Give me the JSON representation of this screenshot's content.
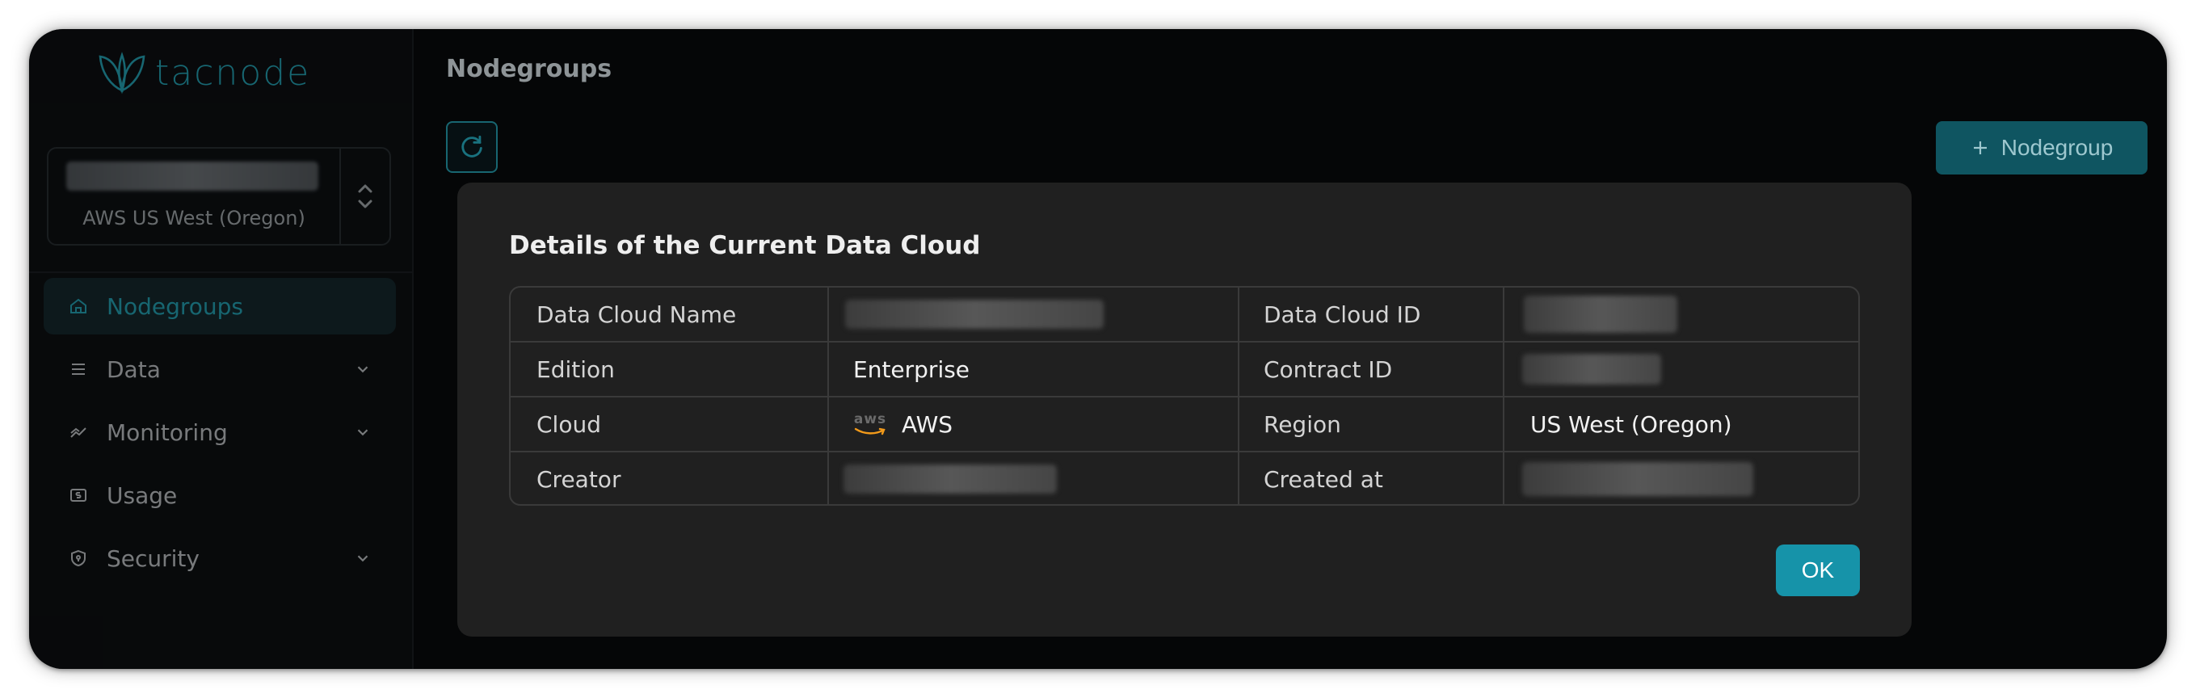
{
  "app": {
    "logo_text": "tacnode"
  },
  "cloud_selector": {
    "region": "AWS US West (Oregon)"
  },
  "sidebar": {
    "items": [
      {
        "label": "Nodegroups",
        "icon": "house-icon",
        "active": true,
        "has_chevron": false
      },
      {
        "label": "Data",
        "icon": "list-icon",
        "active": false,
        "has_chevron": true
      },
      {
        "label": "Monitoring",
        "icon": "trend-icon",
        "active": false,
        "has_chevron": true
      },
      {
        "label": "Usage",
        "icon": "dollar-icon",
        "active": false,
        "has_chevron": false
      },
      {
        "label": "Security",
        "icon": "shield-icon",
        "active": false,
        "has_chevron": true
      }
    ]
  },
  "main": {
    "title": "Nodegroups",
    "add_button_label": "Nodegroup"
  },
  "modal": {
    "title": "Details of the Current Data Cloud",
    "rows": [
      {
        "label1": "Data Cloud Name",
        "value1": "",
        "label2": "Data Cloud ID",
        "value2": ""
      },
      {
        "label1": "Edition",
        "value1": "Enterprise",
        "label2": "Contract ID",
        "value2": ""
      },
      {
        "label1": "Cloud",
        "value1": "AWS",
        "label2": "Region",
        "value2": "US West (Oregon)"
      },
      {
        "label1": "Creator",
        "value1": "",
        "label2": "Created at",
        "value2": ""
      }
    ],
    "aws_logo_text": "aws",
    "ok_label": "OK"
  },
  "colors": {
    "accent": "#27b6c9",
    "ok_button": "#1693a9",
    "modal_bg": "#202020",
    "window_bg": "#050607"
  }
}
